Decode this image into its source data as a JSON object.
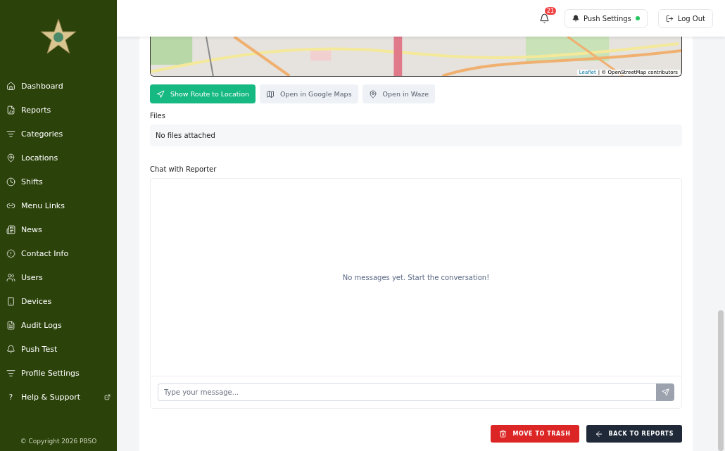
{
  "sidebar": {
    "items": [
      {
        "label": "Dashboard",
        "external": false
      },
      {
        "label": "Reports",
        "external": false
      },
      {
        "label": "Categories",
        "external": false
      },
      {
        "label": "Locations",
        "external": false
      },
      {
        "label": "Shifts",
        "external": false
      },
      {
        "label": "Menu Links",
        "external": false
      },
      {
        "label": "News",
        "external": false
      },
      {
        "label": "Contact Info",
        "external": false
      },
      {
        "label": "Users",
        "external": false
      },
      {
        "label": "Devices",
        "external": false
      },
      {
        "label": "Audit Logs",
        "external": false
      },
      {
        "label": "Push Test",
        "external": false
      },
      {
        "label": "Profile Settings",
        "external": false
      },
      {
        "label": "Help & Support",
        "help_glyph": "?",
        "external": true
      }
    ],
    "copyright": "© Copyright 2026 PBSO"
  },
  "header": {
    "notification_count": "21",
    "push_settings": {
      "label": "Push Settings",
      "on": true
    },
    "logout": "Log Out"
  },
  "map": {
    "attribution_link": "Leaflet",
    "attribution_text": "| © OpenStreetMap contributors"
  },
  "map_actions": [
    {
      "label": "Show Route to Location",
      "kind": "primary"
    },
    {
      "label": "Open in Google Maps",
      "kind": "secondary"
    },
    {
      "label": "Open in Waze",
      "kind": "secondary"
    }
  ],
  "files": {
    "title": "Files",
    "empty": "No files attached"
  },
  "chat": {
    "title": "Chat with Reporter",
    "empty": "No messages yet. Start the conversation!",
    "input": {
      "placeholder": "Type your message..."
    }
  },
  "footer_buttons": [
    {
      "label": "MOVE TO TRASH",
      "kind": "danger"
    },
    {
      "label": "BACK TO REPORTS",
      "kind": "dark"
    }
  ]
}
